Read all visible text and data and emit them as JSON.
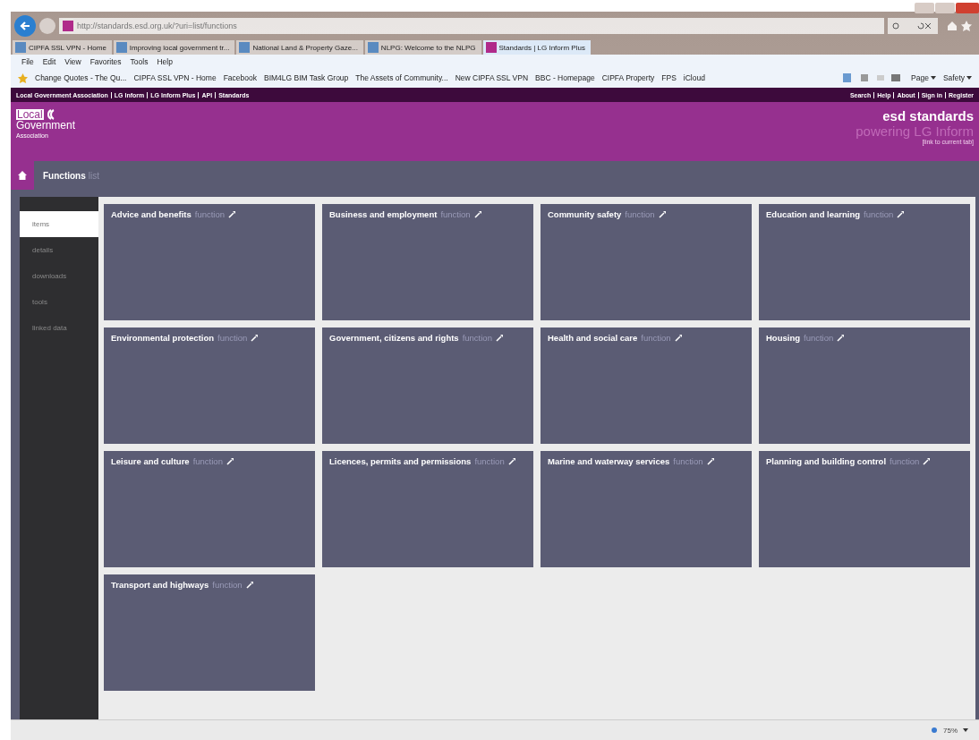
{
  "browser": {
    "address": "http://standards.esd.org.uk/?uri=list/functions",
    "tabs": [
      {
        "label": "CIPFA SSL VPN - Home",
        "selected": false
      },
      {
        "label": "Improving local government tr...",
        "selected": false
      },
      {
        "label": "National Land & Property Gaze...",
        "selected": false
      },
      {
        "label": "NLPG: Welcome to the NLPG",
        "selected": false
      },
      {
        "label": "Standards | LG Inform Plus",
        "selected": true
      }
    ],
    "menu": [
      "File",
      "Edit",
      "View",
      "Favorites",
      "Tools",
      "Help"
    ],
    "favorites": [
      "Change Quotes - The Qu...",
      "CIPFA SSL VPN - Home",
      "Facebook",
      "BIM4LG  BIM Task Group",
      "The Assets of Community...",
      "New CIPFA SSL VPN",
      "BBC - Homepage",
      "CIPFA Property",
      "FPS",
      "iCloud"
    ],
    "commands": [
      "Page",
      "Safety"
    ],
    "zoom": "75%"
  },
  "site": {
    "top_links": [
      "Local Government Association",
      "LG Inform",
      "LG Inform Plus",
      "API",
      "Standards"
    ],
    "account_links": [
      "Search",
      "Help",
      "About",
      "Sign in",
      "Register"
    ],
    "logo": {
      "line_1": "Local",
      "line_2": "Government",
      "line_3": "Association"
    },
    "brand": {
      "title": "esd standards",
      "subtitle": "powering LG Inform",
      "link": "[link to current tab]"
    },
    "breadcrumb": {
      "title": "Functions",
      "view": "list"
    },
    "sidebar": [
      {
        "label": "items",
        "selected": true
      },
      {
        "label": "details",
        "selected": false
      },
      {
        "label": "downloads",
        "selected": false
      },
      {
        "label": "tools",
        "selected": false
      },
      {
        "label": "linked data",
        "selected": false
      }
    ],
    "tiles": [
      {
        "title": "Advice and benefits",
        "type": "function"
      },
      {
        "title": "Business and employment",
        "type": "function"
      },
      {
        "title": "Community safety",
        "type": "function"
      },
      {
        "title": "Education and learning",
        "type": "function"
      },
      {
        "title": "Environmental protection",
        "type": "function"
      },
      {
        "title": "Government, citizens and rights",
        "type": "function"
      },
      {
        "title": "Health and social care",
        "type": "function"
      },
      {
        "title": "Housing",
        "type": "function"
      },
      {
        "title": "Leisure and culture",
        "type": "function"
      },
      {
        "title": "Licences, permits and permissions",
        "type": "function"
      },
      {
        "title": "Marine and waterway services",
        "type": "function"
      },
      {
        "title": "Planning and building control",
        "type": "function"
      },
      {
        "title": "Transport and highways",
        "type": "function"
      }
    ]
  }
}
